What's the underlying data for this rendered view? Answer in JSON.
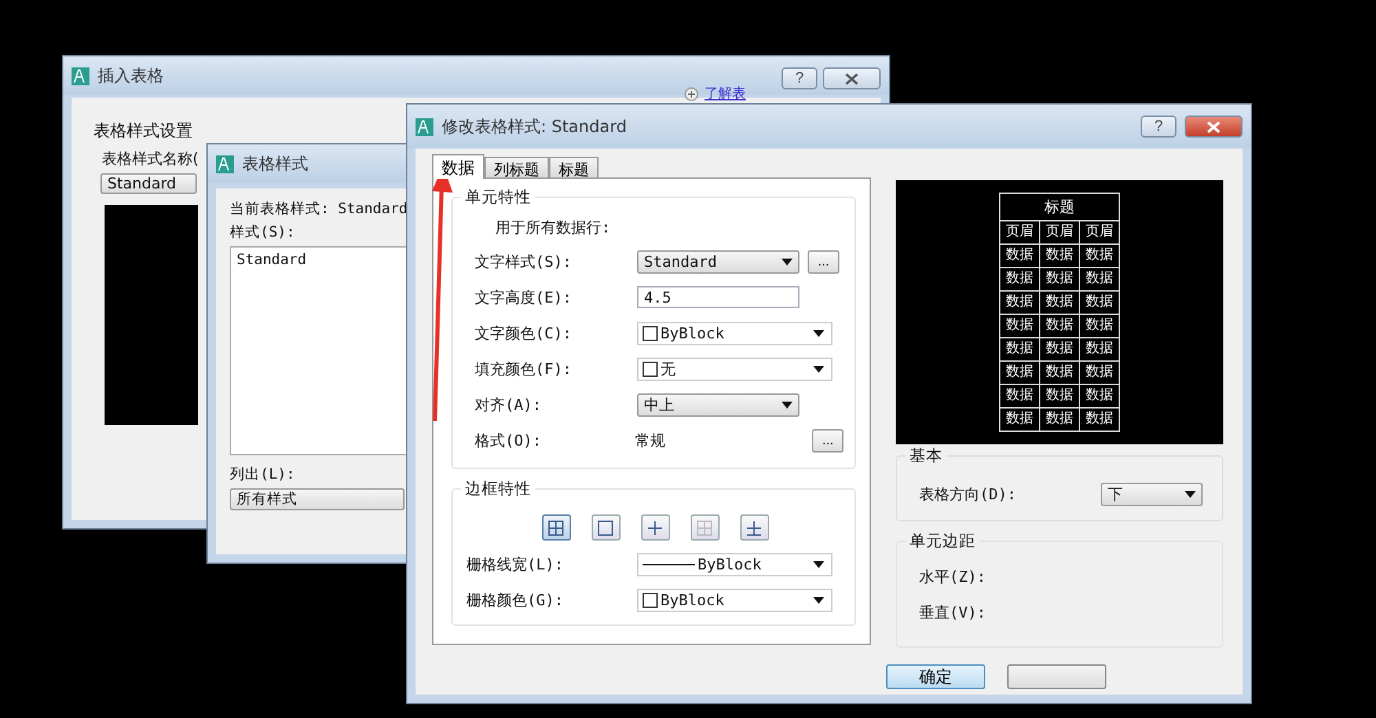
{
  "insert_table_dialog": {
    "title": "插入表格",
    "help": "?",
    "link": "了解表",
    "section": "表格样式设置",
    "style_name_label": "表格样式名称(",
    "style_value": "Standard"
  },
  "table_style_dialog": {
    "title": "表格样式",
    "current": "当前表格样式: Standard",
    "styles_label": "样式(S):",
    "styles": [
      "Standard"
    ],
    "list_label": "列出(L):",
    "list_value": "所有样式"
  },
  "modify_style_dialog": {
    "title": "修改表格样式: Standard",
    "help": "?",
    "tabs": [
      {
        "label": "数据",
        "selected": true
      },
      {
        "label": "列标题",
        "selected": false
      },
      {
        "label": "标题",
        "selected": false
      }
    ],
    "cell_properties": {
      "title": "单元特性",
      "note": "用于所有数据行:",
      "rows": [
        {
          "kind": "dropdown",
          "label": "文字样式(S):",
          "value": "Standard",
          "more": "..."
        },
        {
          "kind": "input",
          "label": "文字高度(E):",
          "value": "4.5"
        },
        {
          "kind": "color",
          "label": "文字颜色(C):",
          "value": "ByBlock"
        },
        {
          "kind": "color",
          "label": "填充颜色(F):",
          "value": "无"
        },
        {
          "kind": "dropdown",
          "label": "对齐(A):",
          "value": "中上"
        },
        {
          "kind": "static",
          "label": "格式(O):",
          "value": "常规",
          "more": "..."
        }
      ]
    },
    "border_properties": {
      "title": "边框特性",
      "borders": [
        {
          "kind": "all",
          "selected": true
        },
        {
          "kind": "outside",
          "selected": false
        },
        {
          "kind": "inside",
          "selected": false
        },
        {
          "kind": "none",
          "selected": false
        },
        {
          "kind": "bottom",
          "selected": false
        }
      ],
      "rows": [
        {
          "kind": "lineweight",
          "label": "栅格线宽(L):",
          "value": "ByBlock"
        },
        {
          "kind": "color",
          "label": "栅格颜色(G):",
          "value": "ByBlock"
        }
      ]
    },
    "preview": {
      "title": "标题",
      "header": [
        "页眉",
        "页眉",
        "页眉"
      ],
      "rows": [
        [
          "数据",
          "数据",
          "数据"
        ],
        [
          "数据",
          "数据",
          "数据"
        ],
        [
          "数据",
          "数据",
          "数据"
        ],
        [
          "数据",
          "数据",
          "数据"
        ],
        [
          "数据",
          "数据",
          "数据"
        ],
        [
          "数据",
          "数据",
          "数据"
        ],
        [
          "数据",
          "数据",
          "数据"
        ],
        [
          "数据",
          "数据",
          "数据"
        ]
      ]
    },
    "basic": {
      "title": "基本",
      "direction_label": "表格方向(D):",
      "direction_value": "下"
    },
    "margins": {
      "title": "单元边距",
      "horizontal_label": "水平(Z):",
      "vertical_label": "垂直(V):"
    },
    "ok_button": "确定"
  }
}
